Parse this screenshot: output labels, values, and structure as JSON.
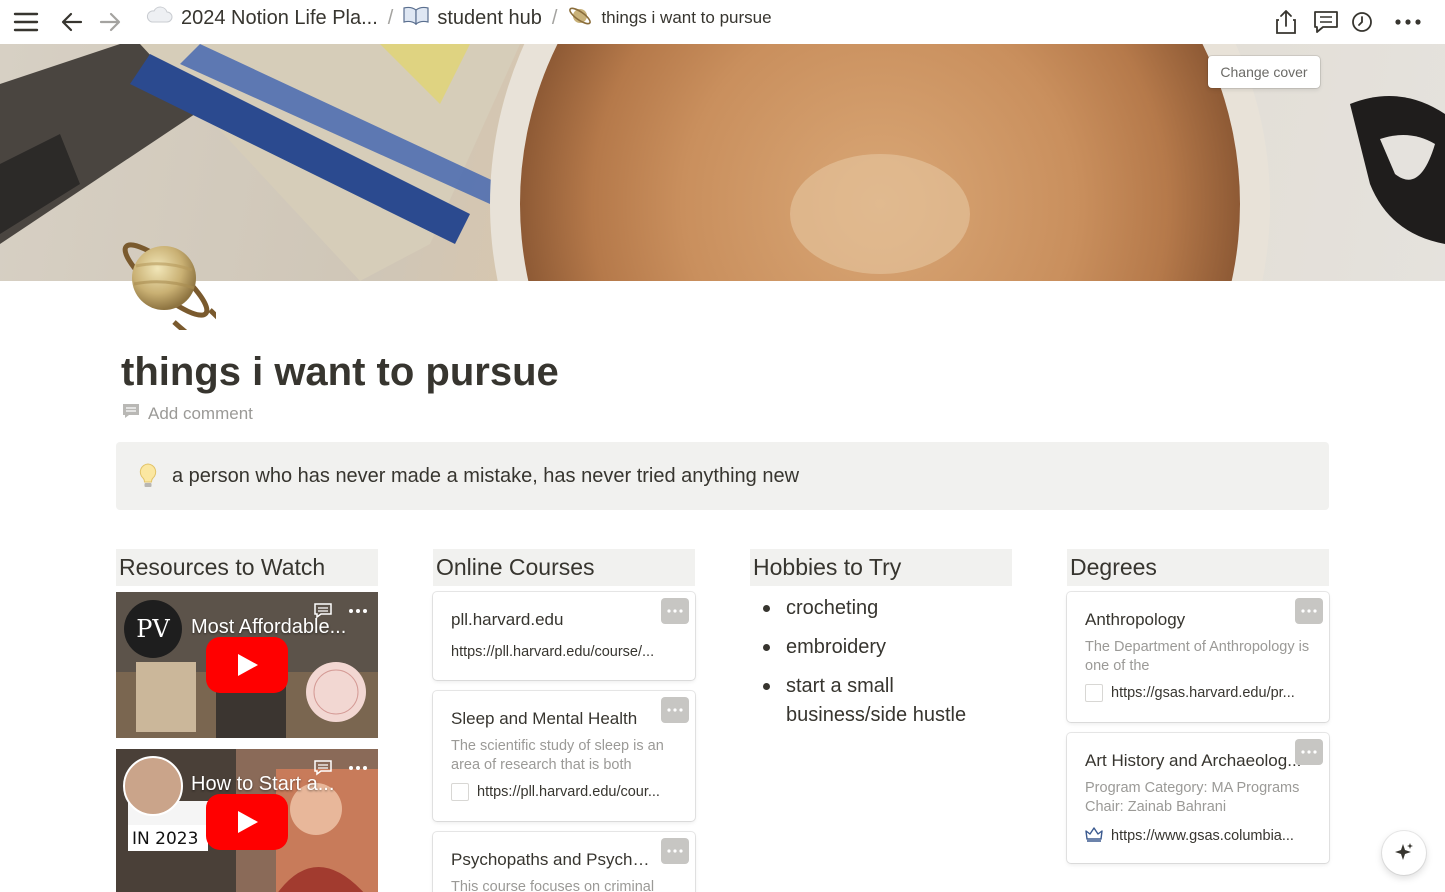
{
  "breadcrumbs": [
    {
      "label": "2024 Notion Life Pla...",
      "icon": "cloud-icon"
    },
    {
      "label": "student hub",
      "icon": "book-icon"
    },
    {
      "label": "things i want to pursue",
      "icon": "saturn-icon"
    }
  ],
  "breadcrumb_separator": "/",
  "cover": {
    "change_label": "Change cover"
  },
  "page": {
    "title": "things i want to pursue",
    "add_comment": "Add comment"
  },
  "callout": {
    "icon": "lightbulb-icon",
    "text": "a person who has never made a mistake, has never tried anything new"
  },
  "columns": {
    "resources": {
      "heading": "Resources to Watch",
      "videos": [
        {
          "title": "Most Affordable..."
        },
        {
          "title": "How to Start a..."
        }
      ]
    },
    "courses": {
      "heading": "Online Courses",
      "cards": [
        {
          "title": "pll.harvard.edu",
          "url": "https://pll.harvard.edu/course/..."
        },
        {
          "title": "Sleep and Mental Health",
          "desc": "The scientific study of sleep is an area of research that is both",
          "url": "https://pll.harvard.edu/cour..."
        },
        {
          "title": "Psychopaths and Psychop...",
          "desc": "This course focuses on criminal"
        }
      ]
    },
    "hobbies": {
      "heading": "Hobbies to Try",
      "items": [
        "crocheting",
        "embroidery",
        "start a small business/side hustle"
      ]
    },
    "degrees": {
      "heading": "Degrees",
      "cards": [
        {
          "title": "Anthropology",
          "desc": "The Department of Anthropology is one of the",
          "url": "https://gsas.harvard.edu/pr..."
        },
        {
          "title": "Art History and Archaeolog...",
          "desc": "Program Category: MA Programs Chair: Zainab Bahrani",
          "url": "https://www.gsas.columbia..."
        }
      ]
    }
  },
  "colors": {
    "callout_bg": "#f1f1ef",
    "heading_bg": "#f1f1ef",
    "text": "#37352f",
    "muted": "#9b9a97",
    "youtube_red": "#ff0000"
  }
}
